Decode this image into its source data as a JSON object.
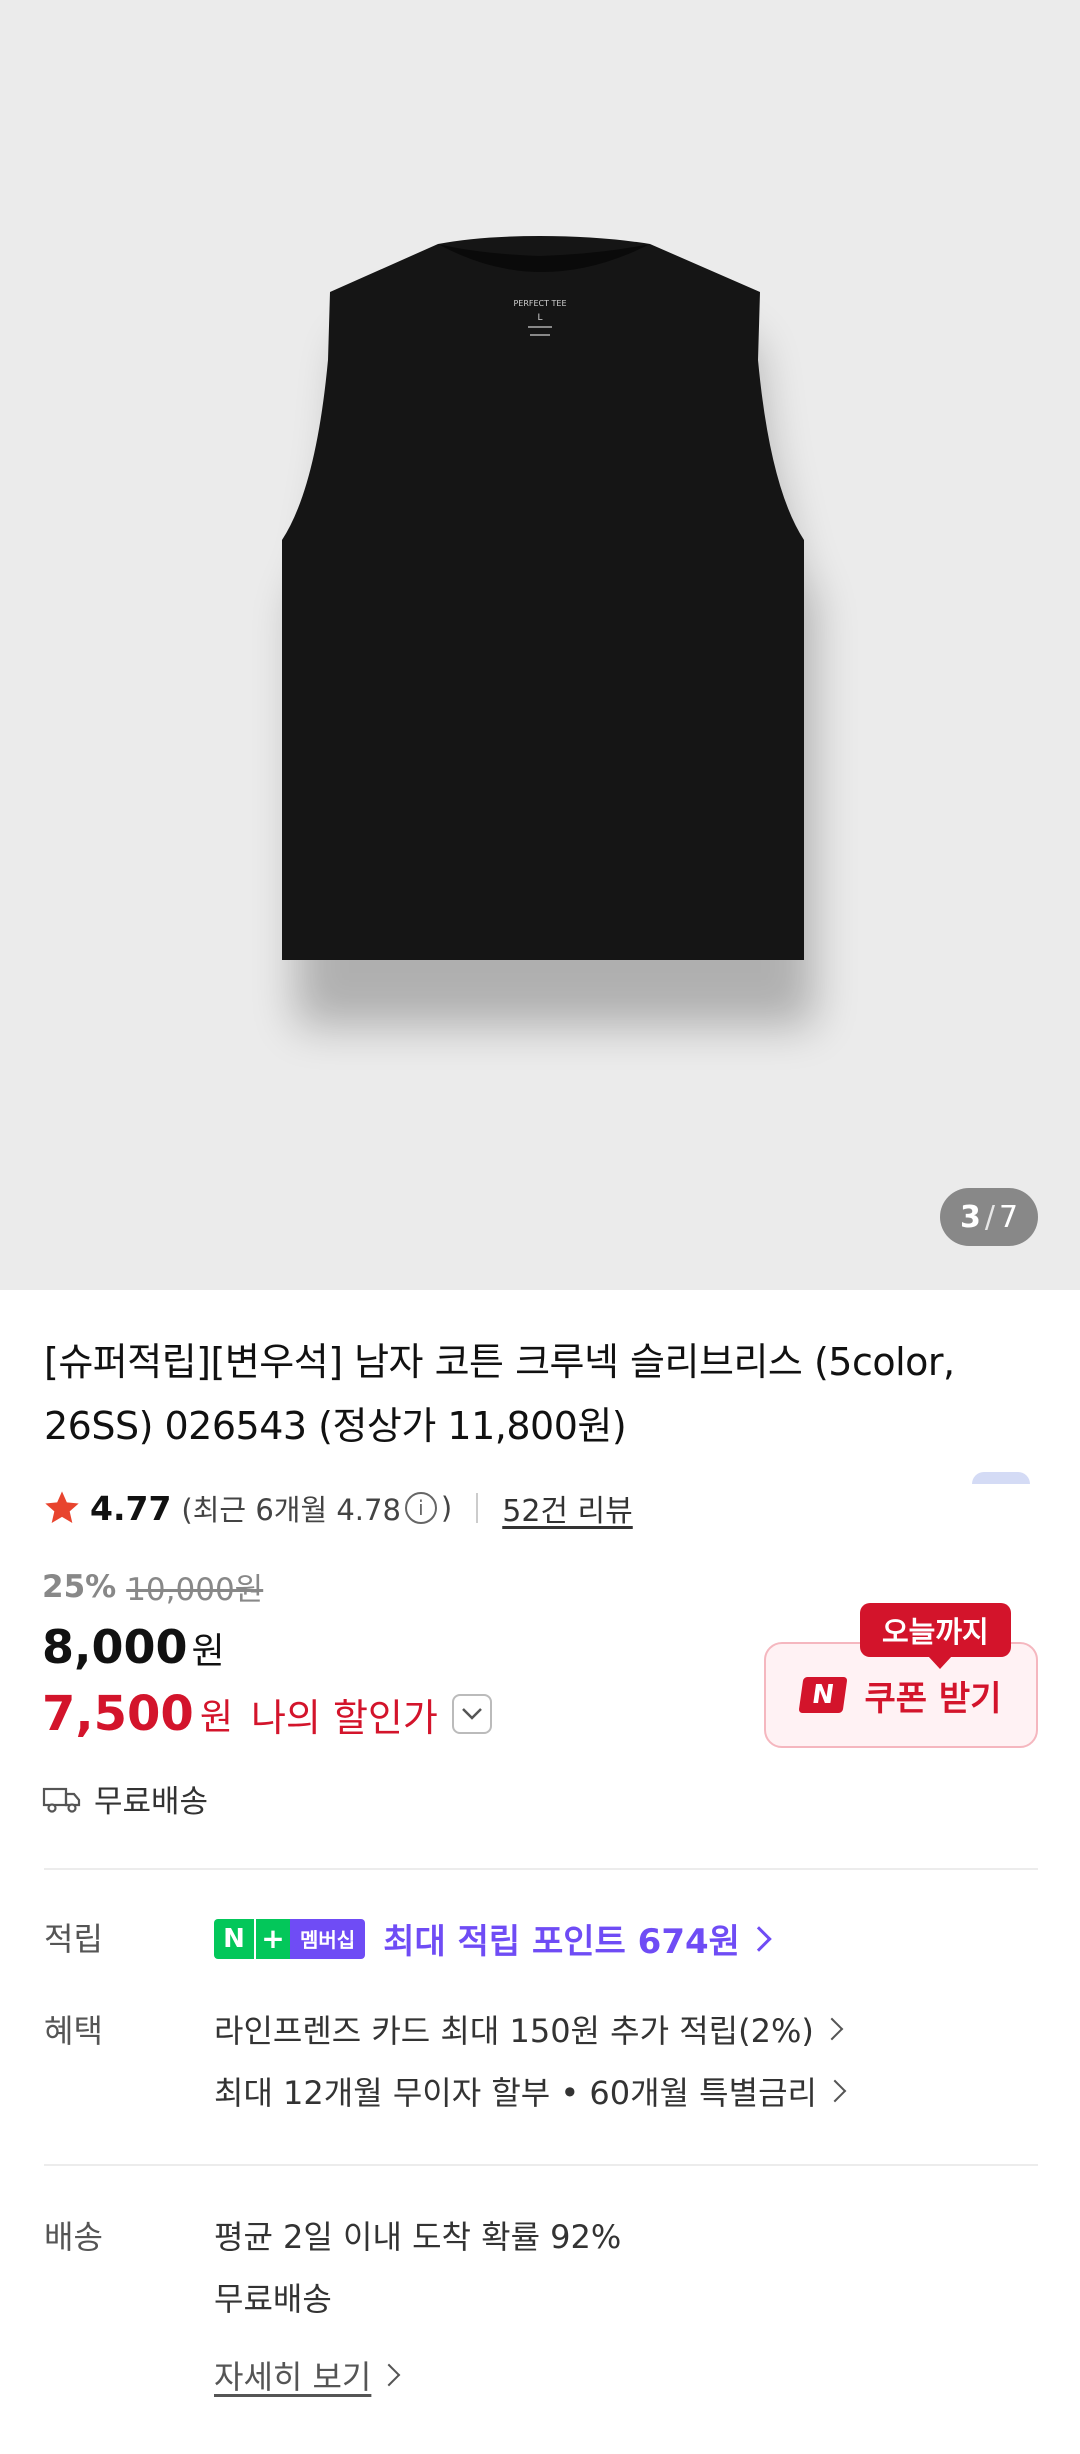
{
  "gallery": {
    "page_current": "3",
    "page_total": "7",
    "separator": "/",
    "tag_text": "PERFECT TEE",
    "tag_size": "L"
  },
  "product": {
    "title": "[슈퍼적립][변우석] 남자 코튼 크루넥 슬리브리스 (5color, 26SS) 026543 (정상가 11,800원)",
    "rating": "4.77",
    "recent_rating": "(최근 6개월 4.78",
    "recent_close": ")",
    "info_icon": "i",
    "review_count": "52건 리뷰",
    "discount_rate": "25%",
    "original_price": "10,000원",
    "price": "8,000",
    "price_unit": "원",
    "my_price": "7,500",
    "my_price_unit": "원",
    "my_price_label": "나의 할인가",
    "shipping": "무료배송"
  },
  "coupon": {
    "tag": "오늘까지",
    "logo": "N",
    "label": "쿠폰 받기"
  },
  "points": {
    "label": "적립",
    "badge_n": "N",
    "badge_plus": "+",
    "badge_text": "멤버십",
    "text": "최대 적립 포인트 674원"
  },
  "benefits": {
    "label": "혜택",
    "items": [
      "라인프렌즈 카드 최대 150원 추가 적립(2%)",
      "최대 12개월 무이자 할부 • 60개월 특별금리"
    ]
  },
  "delivery": {
    "label": "배송",
    "probability": "평균 2일 이내 도착 확률 92%",
    "fee": "무료배송",
    "detail_link": "자세히 보기"
  },
  "colors": {
    "accent_red": "#d3142b",
    "point_purple": "#6f4cf5",
    "naver_green": "#03c75a",
    "star": "#e8442e"
  },
  "icons": {
    "rating": "star-icon",
    "shipping": "truck-icon",
    "info": "info-icon",
    "dropdown": "chevron-down-icon",
    "more": "chevron-right-icon"
  }
}
